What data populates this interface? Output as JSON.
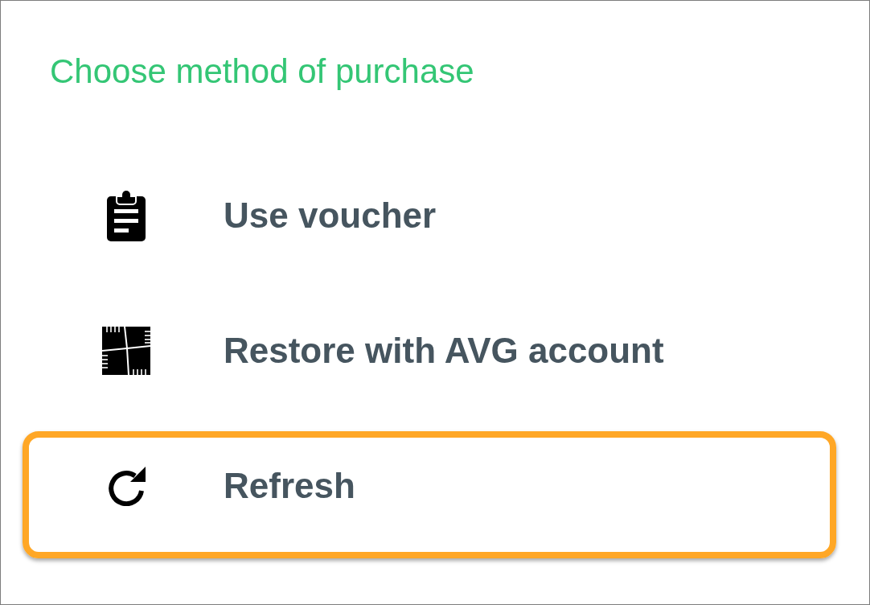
{
  "title": "Choose method of purchase",
  "options": [
    {
      "kind": "voucher",
      "label": "Use voucher",
      "highlighted": false
    },
    {
      "kind": "account",
      "label": "Restore with AVG account",
      "highlighted": false
    },
    {
      "kind": "refresh",
      "label": "Refresh",
      "highlighted": true
    }
  ]
}
